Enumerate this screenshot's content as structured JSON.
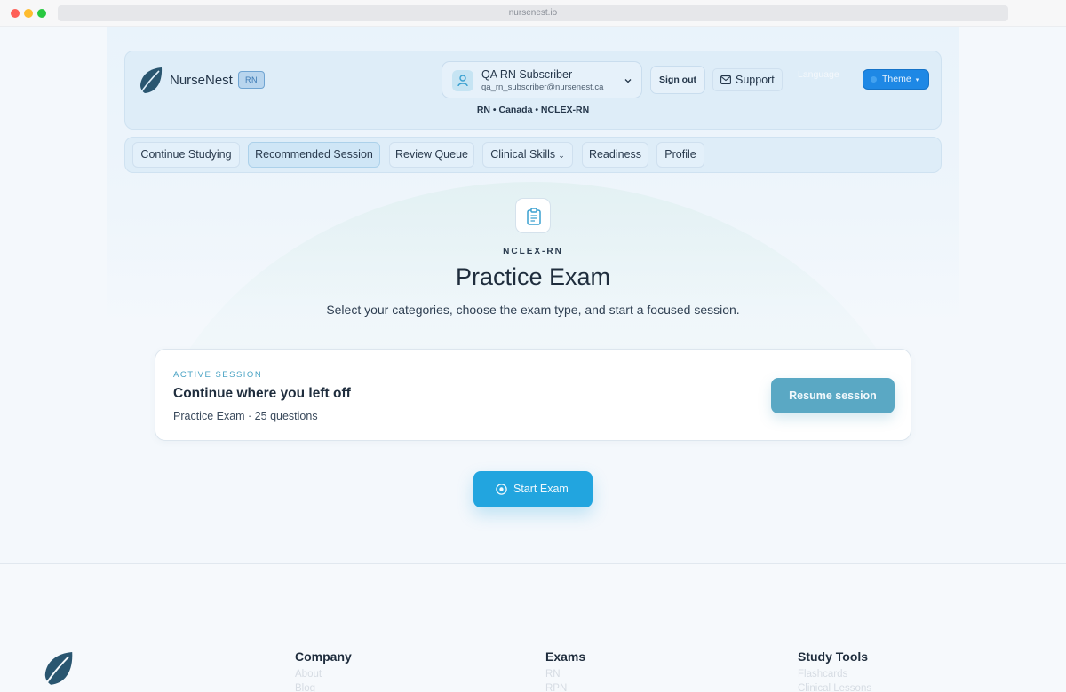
{
  "browser": {
    "url": "nursenest.io"
  },
  "header": {
    "brand_name": "NurseNest",
    "brand_badge": "RN",
    "user": {
      "name": "QA RN Subscriber",
      "email": "qa_rn_subscriber@nursenest.ca"
    },
    "sign_out_label": "Sign out",
    "support_label": "Support",
    "language_label": "Language",
    "theme_label": "Theme",
    "subline": "RN • Canada • NCLEX-RN"
  },
  "nav": {
    "items": [
      {
        "label": "Continue Studying"
      },
      {
        "label": "Recommended Session",
        "active": true
      },
      {
        "label": "Review Queue"
      },
      {
        "label": "Clinical Skills",
        "has_dropdown": true
      },
      {
        "label": "Readiness"
      },
      {
        "label": "Profile"
      }
    ]
  },
  "hero": {
    "eyebrow": "NCLEX-RN",
    "title": "Practice Exam",
    "subtitle": "Select your categories, choose the exam type, and start a focused session."
  },
  "active_session": {
    "eyebrow": "ACTIVE SESSION",
    "title": "Continue where you left off",
    "meta": "Practice Exam · 25 questions",
    "resume_label": "Resume session"
  },
  "start_exam_label": "Start Exam",
  "footer": {
    "columns": [
      {
        "heading": "Company",
        "links": [
          "About",
          "Blog"
        ]
      },
      {
        "heading": "Exams",
        "links": [
          "RN",
          "RPN"
        ]
      },
      {
        "heading": "Study Tools",
        "links": [
          "Flashcards",
          "Clinical Lessons"
        ]
      }
    ]
  },
  "colors": {
    "accent": "#22a5df",
    "theme_button": "#1e88e5",
    "resume_button": "#5aa8c4",
    "brand_leaf": "#2a5670"
  },
  "icons": [
    "leaf-logo-icon",
    "user-icon",
    "chevron-down-icon",
    "mail-icon",
    "clipboard-icon",
    "play-circle-icon"
  ]
}
